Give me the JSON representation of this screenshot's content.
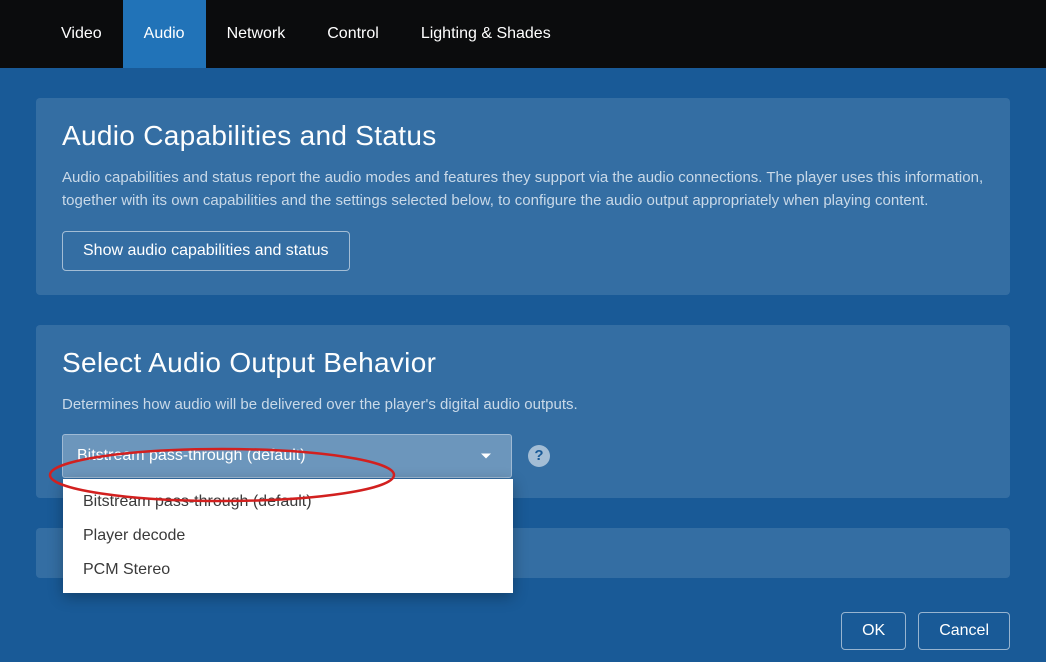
{
  "nav": {
    "tabs": [
      "Video",
      "Audio",
      "Network",
      "Control",
      "Lighting & Shades"
    ],
    "active_index": 1
  },
  "panel_caps": {
    "title": "Audio Capabilities and Status",
    "desc": "Audio capabilities and status report the audio modes and features they support via the audio connections. The player uses this information, together with its own capabilities and the settings selected below, to configure the audio output appropriately when playing content.",
    "button": "Show audio capabilities and status"
  },
  "panel_behavior": {
    "title": "Select Audio Output Behavior",
    "desc": "Determines how audio will be delivered over the player's digital audio outputs.",
    "selected": "Bitstream pass-through (default)",
    "options": [
      "Bitstream pass-through (default)",
      "Player decode",
      "PCM Stereo"
    ],
    "help_glyph": "?"
  },
  "footer": {
    "ok": "OK",
    "cancel": "Cancel"
  }
}
